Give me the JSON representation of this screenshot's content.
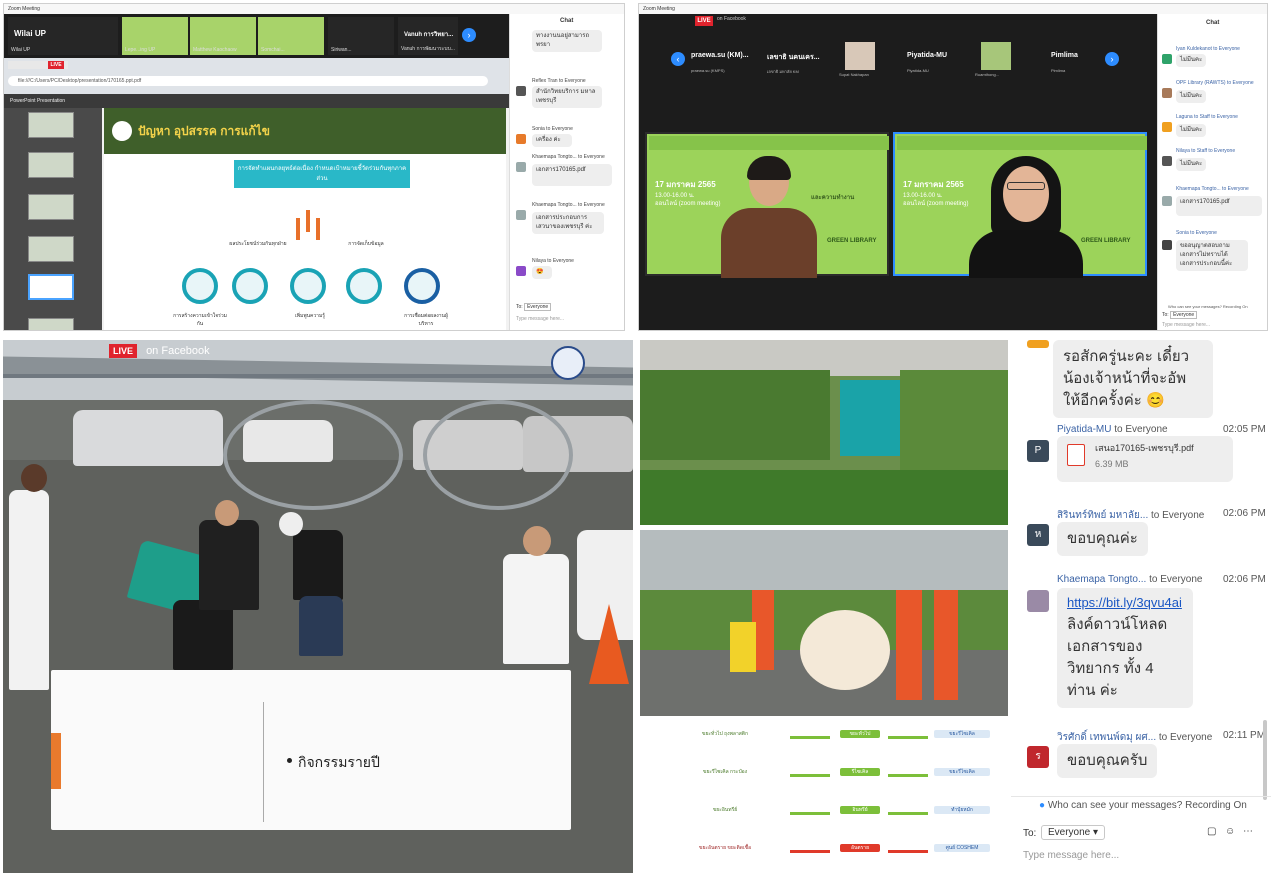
{
  "panel_a": {
    "window_title": "Zoom Meeting",
    "tiles": [
      {
        "name": "Wilai UP",
        "label": "Wilai UP"
      },
      {
        "name": "",
        "label": "Lepe...ing UP"
      },
      {
        "name": "",
        "label": "Matthew Kaochaow"
      },
      {
        "name": "",
        "label": "Somchai..."
      },
      {
        "name": "",
        "label": "Siriwan..."
      },
      {
        "name": "Vanuh การวิทยา...",
        "label": "Vanuh การพัฒนาระบบ..."
      }
    ],
    "browser_url": "file:///C:/Users/PC/Desktop/presentation/170165.ppt.pdf",
    "ppt_label": "PowerPoint Presentation",
    "slide_title": "ปัญหา อุปสรรค การแก้ไข",
    "banner_text": "การจัดทำแผนกลยุทธ์ต่อเนื่อง กำหนดเป้าหมายชี้วัดร่วมกันทุกภาคส่วน",
    "flow_labels": [
      "การสร้างความเข้าใจร่วมกัน",
      "ผลประโยชน์ร่วมกันทุกฝ่าย",
      "เพิ่มพูนความรู้",
      "การจัดเก็บข้อมูล",
      "การเชื่อมต่อผลงานผู้บริหาร"
    ],
    "chat_title": "Chat",
    "chat": [
      {
        "from": "",
        "text": "ทางงานนอยู่สามารถ พรยา"
      },
      {
        "from": "Reflex Tran to Everyone",
        "text": "สำนักวิทยบริการ มหาลเพชรบุรี"
      },
      {
        "from": "Sonia to Everyone",
        "text": "เครื่อง ค่ะ"
      },
      {
        "from": "Khaemapa Tongto... to Everyone",
        "text": "เอกสาร170165.pdf"
      },
      {
        "from": "Khaemapa Tongto... to Everyone",
        "text": "เอกสารประกอบการ เสวนาของเพชรบุรี ค่ะ"
      },
      {
        "from": "Nilaya to Everyone",
        "text": "😍"
      }
    ],
    "to_label": "To:",
    "to_value": "Everyone",
    "placeholder": "Type message here..."
  },
  "panel_b": {
    "window_title": "Zoom Meeting",
    "live_badge": "LIVE",
    "live_on": "on Facebook",
    "participants": [
      "praewa.su (KM)...",
      "เลขาธิ นคนเคร...",
      "",
      "Piyatida-MU",
      "",
      "Pimlima"
    ],
    "participant_subs": [
      "praewa.su (KMPS)",
      "เลขาธิ มหาลัย KM",
      "Supat Nakhapan",
      "Piyatida-MU",
      "Ruamthong...",
      "Pimlima"
    ],
    "slide_date": "17 มกราคม 2565",
    "slide_time": "13.00-16.00 น.",
    "slide_mode": "ออนไลน์ (zoom meeting)",
    "slide_caption": "และความทำงาน",
    "green_library": "GREEN LIBRARY",
    "chat_title": "Chat",
    "chat": [
      {
        "from": "Iyan Kuldekanot to Everyone",
        "text": "ไม่มีนคะ"
      },
      {
        "from": "OPF Library (RAWTS) to Everyone",
        "text": "ไม่มีนคะ"
      },
      {
        "from": "Laguna to Staff to Everyone",
        "text": "ไม่มีนคะ"
      },
      {
        "from": "Nilaya to Staff to Everyone",
        "text": "ไม่มีนคะ"
      },
      {
        "from": "Khaemapa Tongto... to Everyone",
        "text": "เอกสาร170165.pdf"
      },
      {
        "from": "Sonia to Everyone",
        "text": "ขออนุญาตสอบถามเอกสารไม่ทราบได้ เอกสารประกอบนี้ค่ะ"
      }
    ],
    "privacy": "Who can see your messages? Recording On",
    "to_label": "To:",
    "to_value": "Everyone",
    "placeholder": "Type message here..."
  },
  "panel_c": {
    "live_badge": "LIVE",
    "live_on": "on Facebook",
    "overlay_bullet": "กิจกรรมรายปี"
  },
  "panel_d": {
    "recycle_rows": [
      {
        "left": "ขยะทั่วไป ถุงพลาสติก",
        "mid": "ขยะทั่วไป",
        "right": "ขยะรีไซเคิล"
      },
      {
        "left": "ขยะรีไซเคิล กระป๋อง",
        "mid": "รีไซเคิล",
        "right": "ขยะรีไซเคิล"
      },
      {
        "left": "ขยะอินทรีย์",
        "mid": "อินทรีย์",
        "right": "ทำปุ๋ยหมัก"
      },
      {
        "left": "ขยะอันตราย ขยะติดเชื้อ",
        "mid": "อันตราย",
        "right": "ศูนย์ COSHEM"
      }
    ]
  },
  "panel_e": {
    "top_bubble": "รอสักครู่นะคะ เดี๋ยว น้องเจ้าหน้าที่จะอัพ ให้อีกครั้งค่ะ 😊",
    "messages": [
      {
        "from": "Piyatida-MU",
        "to": "to Everyone",
        "time": "02:05 PM",
        "avatar": "P",
        "file_name": "เสนอ170165-เพชรบุรี.pdf",
        "file_size": "6.39 MB"
      },
      {
        "from": "สิรินทร์ทิพย์ มหาลัย...",
        "to": "to Everyone",
        "time": "02:06 PM",
        "avatar": "ห",
        "text": "ขอบคุณค่ะ"
      },
      {
        "from": "Khaemapa Tongto...",
        "to": "to Everyone",
        "time": "02:06 PM",
        "avatar": "",
        "link": "https://bit.ly/3qvu4ai",
        "text": "ลิงค์ดาวน์โหลด เอกสารของ วิทยากร ทั้ง 4 ท่าน ค่ะ"
      },
      {
        "from": "วิรศักดิ์ เทพนพ์ดมุ ผศ...",
        "to": "to Everyone",
        "time": "02:11 PM",
        "avatar": "ร",
        "text": "ขอบคุณครับ"
      }
    ],
    "privacy": "Who can see your messages? Recording On",
    "to_label": "To:",
    "to_value": "Everyone",
    "placeholder": "Type message here..."
  },
  "colors": {
    "zoom_blue": "#2d8cff",
    "live_red": "#e0232d",
    "slide_green": "#9cd35a",
    "link_blue": "#1a57c4"
  }
}
